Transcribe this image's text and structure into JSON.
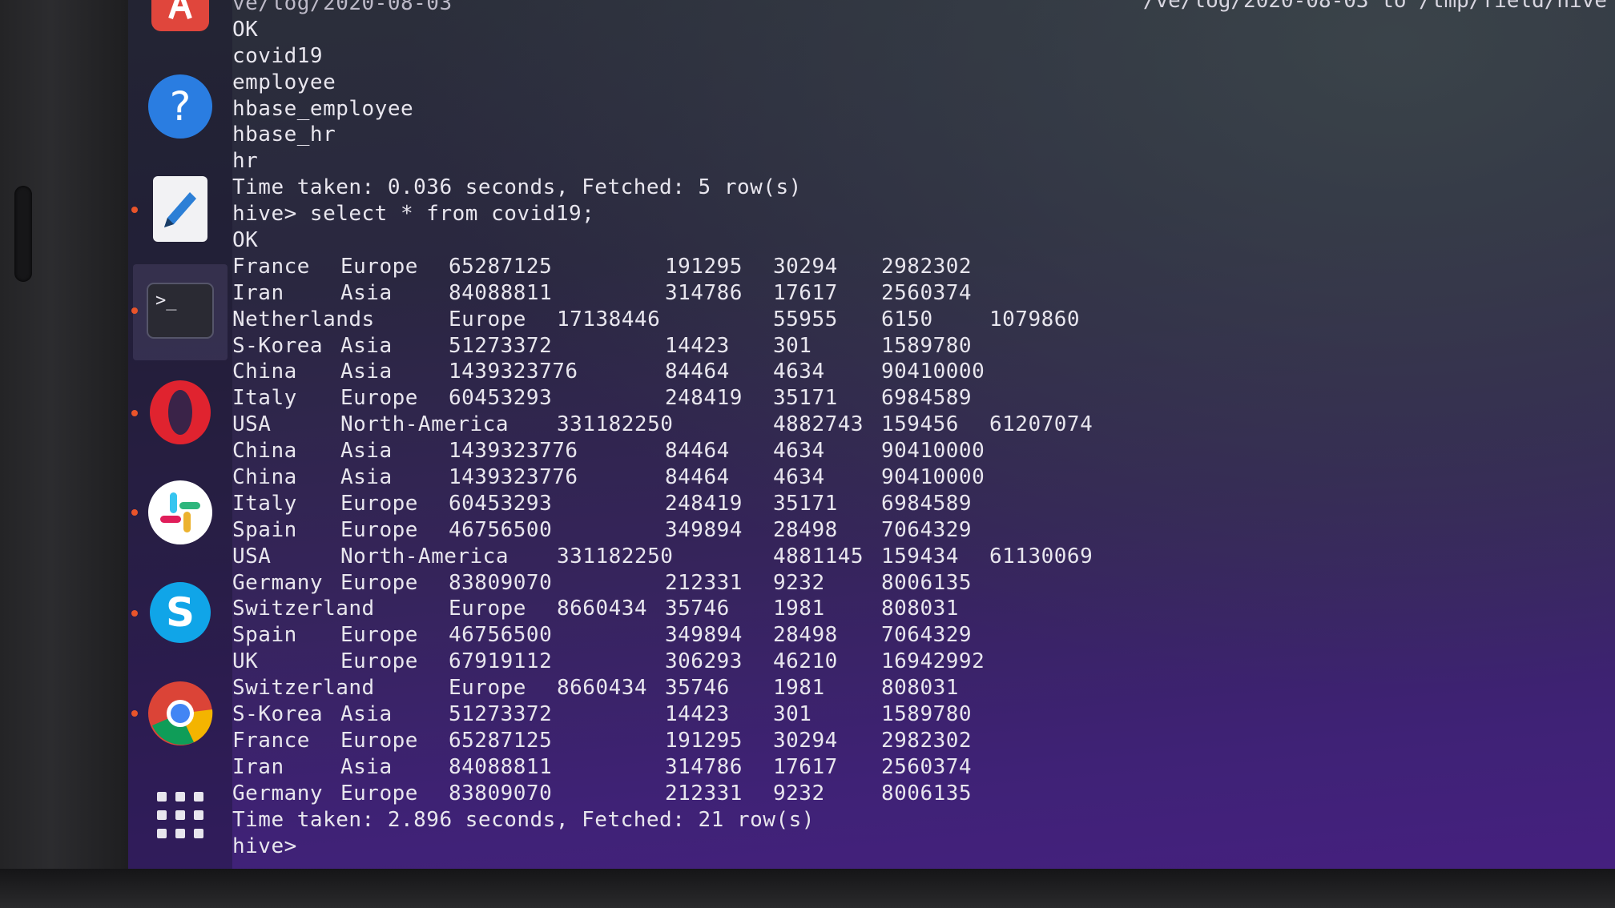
{
  "terminal": {
    "header_fragment": "ve/log/2020-08-03",
    "header_right_fragment": "/ve/log/2020-08-03 to /tmp/field/hive",
    "pre_lines": [
      "OK",
      "covid19",
      "employee",
      "hbase_employee",
      "hbase_hr",
      "hr",
      "Time taken: 0.036 seconds, Fetched: 5 row(s)",
      "hive> select * from covid19;",
      "OK"
    ],
    "rows": [
      [
        "France",
        "Europe",
        "65287125",
        "",
        "191295",
        "30294",
        "2982302",
        ""
      ],
      [
        "Iran",
        "Asia",
        "84088811",
        "",
        "314786",
        "17617",
        "2560374",
        ""
      ],
      [
        "Netherlands",
        "",
        "Europe",
        "17138446",
        "",
        "55955",
        "6150",
        "1079860"
      ],
      [
        "S-Korea",
        "Asia",
        "51273372",
        "",
        "14423",
        "301",
        "1589780",
        ""
      ],
      [
        "China",
        "Asia",
        "1439323776",
        "",
        "84464",
        "4634",
        "90410000",
        ""
      ],
      [
        "Italy",
        "Europe",
        "60453293",
        "",
        "248419",
        "35171",
        "6984589",
        ""
      ],
      [
        "USA",
        "North-America",
        "",
        "331182250",
        "",
        "4882743",
        "159456",
        "61207074"
      ],
      [
        "China",
        "Asia",
        "1439323776",
        "",
        "84464",
        "4634",
        "90410000",
        ""
      ],
      [
        "China",
        "Asia",
        "1439323776",
        "",
        "84464",
        "4634",
        "90410000",
        ""
      ],
      [
        "Italy",
        "Europe",
        "60453293",
        "",
        "248419",
        "35171",
        "6984589",
        ""
      ],
      [
        "Spain",
        "Europe",
        "46756500",
        "",
        "349894",
        "28498",
        "7064329",
        ""
      ],
      [
        "USA",
        "North-America",
        "",
        "331182250",
        "",
        "4881145",
        "159434",
        "61130069"
      ],
      [
        "Germany",
        "Europe",
        "83809070",
        "",
        "212331",
        "9232",
        "8006135",
        ""
      ],
      [
        "Switzerland",
        "",
        "Europe",
        "8660434",
        "35746",
        "1981",
        "808031",
        ""
      ],
      [
        "Spain",
        "Europe",
        "46756500",
        "",
        "349894",
        "28498",
        "7064329",
        ""
      ],
      [
        "UK",
        "Europe",
        "67919112",
        "",
        "306293",
        "46210",
        "16942992",
        ""
      ],
      [
        "Switzerland",
        "",
        "Europe",
        "8660434",
        "35746",
        "1981",
        "808031",
        ""
      ],
      [
        "S-Korea",
        "Asia",
        "51273372",
        "",
        "14423",
        "301",
        "1589780",
        ""
      ],
      [
        "France",
        "Europe",
        "65287125",
        "",
        "191295",
        "30294",
        "2982302",
        ""
      ],
      [
        "Iran",
        "Asia",
        "84088811",
        "",
        "314786",
        "17617",
        "2560374",
        ""
      ],
      [
        "Germany",
        "Europe",
        "83809070",
        "",
        "212331",
        "9232",
        "8006135",
        ""
      ]
    ],
    "post_lines": [
      "Time taken: 2.896 seconds, Fetched: 21 row(s)",
      "hive> "
    ]
  },
  "dock": {
    "items": [
      {
        "name": "software-center-icon",
        "color": "#e0463c"
      },
      {
        "name": "help-icon",
        "color": "#2a7de1",
        "glyph": "?"
      },
      {
        "name": "text-editor-icon",
        "color": "#2c7fd6"
      },
      {
        "name": "terminal-icon",
        "color": "#2a2a33",
        "glyph": ">_"
      },
      {
        "name": "opera-icon",
        "color": "#e0232f"
      },
      {
        "name": "slack-icon",
        "color": "#ffffff"
      },
      {
        "name": "skype-icon",
        "color": "#10a5e8",
        "glyph": "S"
      },
      {
        "name": "chrome-icon",
        "color": "#4285f4"
      },
      {
        "name": "app-grid-icon",
        "color": "#e8e6ee"
      }
    ]
  }
}
